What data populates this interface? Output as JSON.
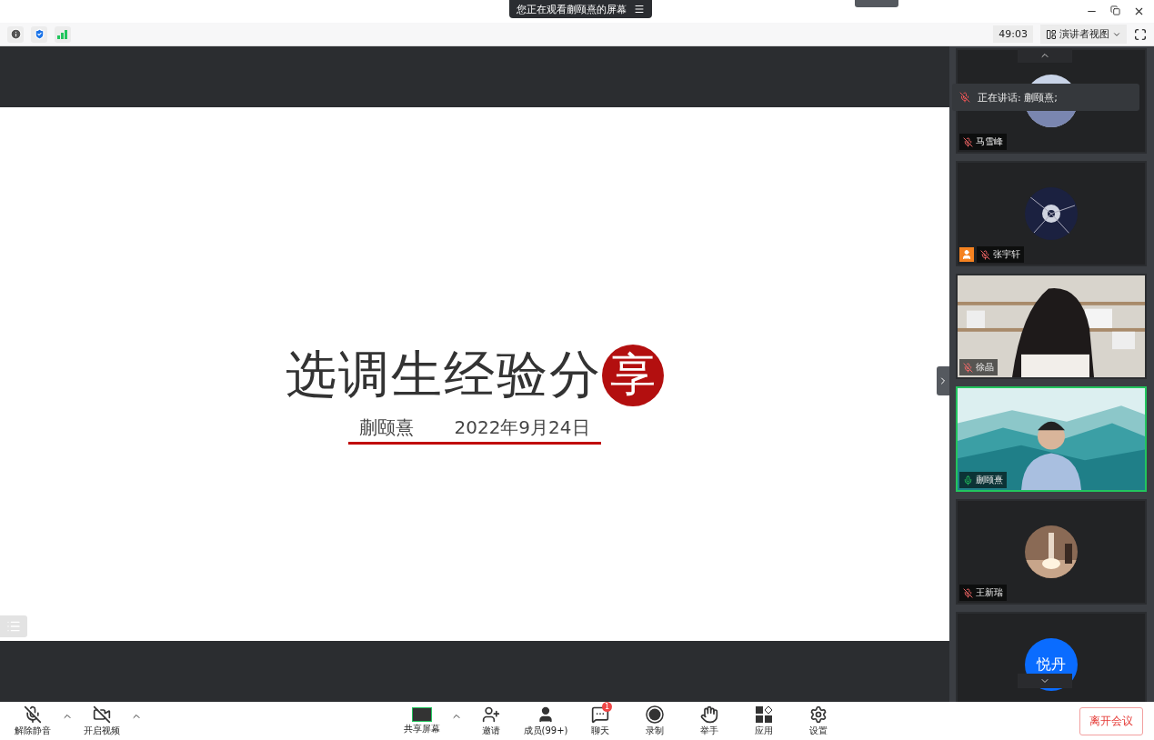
{
  "window": {
    "banner": "您正在观看蒯颐熹的屏幕"
  },
  "toolbar": {
    "timer": "49:03",
    "view_button": "演讲者视图"
  },
  "slide": {
    "title": "选调生经验分",
    "title_mark": "享",
    "presenter": "蒯颐熹",
    "date": "2022年9月24日"
  },
  "speaking": {
    "text": "正在讲话: 蒯颐熹;"
  },
  "participants": [
    {
      "name": "马雪峰",
      "kind": "avatar",
      "muted": true,
      "host": false,
      "active": false
    },
    {
      "name": "张宇轩",
      "kind": "avatar",
      "muted": true,
      "host": true,
      "active": false
    },
    {
      "name": "徐晶",
      "kind": "video",
      "muted": true,
      "host": false,
      "active": false
    },
    {
      "name": "蒯颐熹",
      "kind": "video",
      "muted": false,
      "host": false,
      "active": true
    },
    {
      "name": "王新瑞",
      "kind": "avatar",
      "muted": true,
      "host": false,
      "active": false
    },
    {
      "initials": "悦丹",
      "kind": "initials",
      "active": false
    }
  ],
  "controls": [
    {
      "label": "解除静音",
      "kind": "mic",
      "menu": true
    },
    {
      "label": "开启视频",
      "kind": "video",
      "menu": true
    },
    {
      "label": "共享屏幕",
      "kind": "share",
      "menu": true
    },
    {
      "label": "邀请",
      "kind": "invite"
    },
    {
      "label": "成员(99+)",
      "kind": "members"
    },
    {
      "label": "聊天",
      "kind": "chat",
      "badge": "1"
    },
    {
      "label": "录制",
      "kind": "record"
    },
    {
      "label": "举手",
      "kind": "hand"
    },
    {
      "label": "应用",
      "kind": "apps"
    },
    {
      "label": "设置",
      "kind": "settings"
    }
  ],
  "leave_button": "离开会议"
}
